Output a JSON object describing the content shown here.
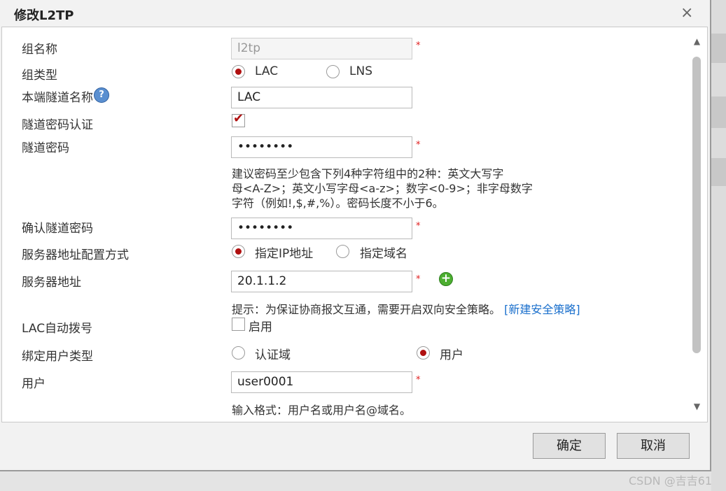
{
  "dialog": {
    "title": "修改L2TP",
    "close_icon": "×"
  },
  "form": {
    "group_name": {
      "label": "组名称",
      "value": "l2tp",
      "required": "*"
    },
    "group_type": {
      "label": "组类型",
      "options": [
        "LAC",
        "LNS"
      ],
      "selected": "LAC"
    },
    "local_tunnel_name": {
      "label": "本端隧道名称",
      "help": "?",
      "value": "LAC"
    },
    "tunnel_password_auth": {
      "label": "隧道密码认证",
      "checked": true,
      "check_mark": "✔"
    },
    "tunnel_password": {
      "label": "隧道密码",
      "value": "••••••••",
      "required": "*",
      "hint_line1": "建议密码至少包含下列4种字符组中的2种：英文大写字",
      "hint_line2": "母<A-Z>；英文小写字母<a-z>；数字<0-9>；非字母数字",
      "hint_line3": "字符（例如!,$,#,%）。密码长度不小于6。"
    },
    "confirm_tunnel_password": {
      "label": "确认隧道密码",
      "value": "••••••••",
      "required": "*"
    },
    "server_address_config": {
      "label": "服务器地址配置方式",
      "options": [
        "指定IP地址",
        "指定域名"
      ],
      "selected": "指定IP地址"
    },
    "server_address": {
      "label": "服务器地址",
      "value": "20.1.1.2",
      "required": "*",
      "add_icon": "+",
      "hint_prefix": "提示：为保证协商报文互通，需要开启双向安全策略。",
      "hint_link": "[新建安全策略]"
    },
    "lac_auto_dial": {
      "label": "LAC自动拨号",
      "checkbox_label": "启用",
      "checked": false
    },
    "bind_user_type": {
      "label": "绑定用户类型",
      "options": [
        "认证域",
        "用户"
      ],
      "selected": "用户"
    },
    "user": {
      "label": "用户",
      "value": "user0001",
      "required": "*",
      "hint": "输入格式：用户名或用户名@域名。"
    }
  },
  "scroll": {
    "up": "▲",
    "down": "▼"
  },
  "buttons": {
    "ok": "确定",
    "cancel": "取消"
  },
  "watermark": "CSDN @吉吉61"
}
